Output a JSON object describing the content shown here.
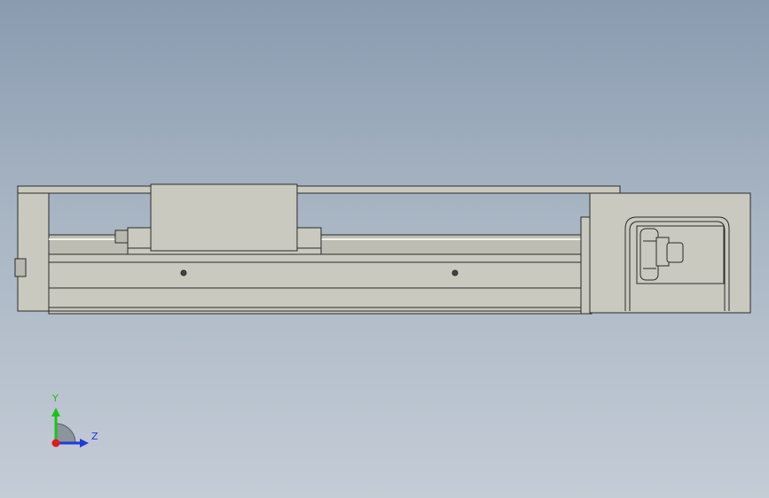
{
  "viewport": {
    "background_top": "#8a9bb0",
    "background_bottom": "#c4ccd6"
  },
  "model": {
    "fill_color": "#c9c9bf",
    "edge_color": "#2b2b2b"
  },
  "triad": {
    "y_axis": {
      "label": "Y",
      "color": "#19c419"
    },
    "z_axis": {
      "label": "Z",
      "color": "#1f3ad8"
    },
    "x_axis": {
      "color": "#e01b1b"
    }
  }
}
